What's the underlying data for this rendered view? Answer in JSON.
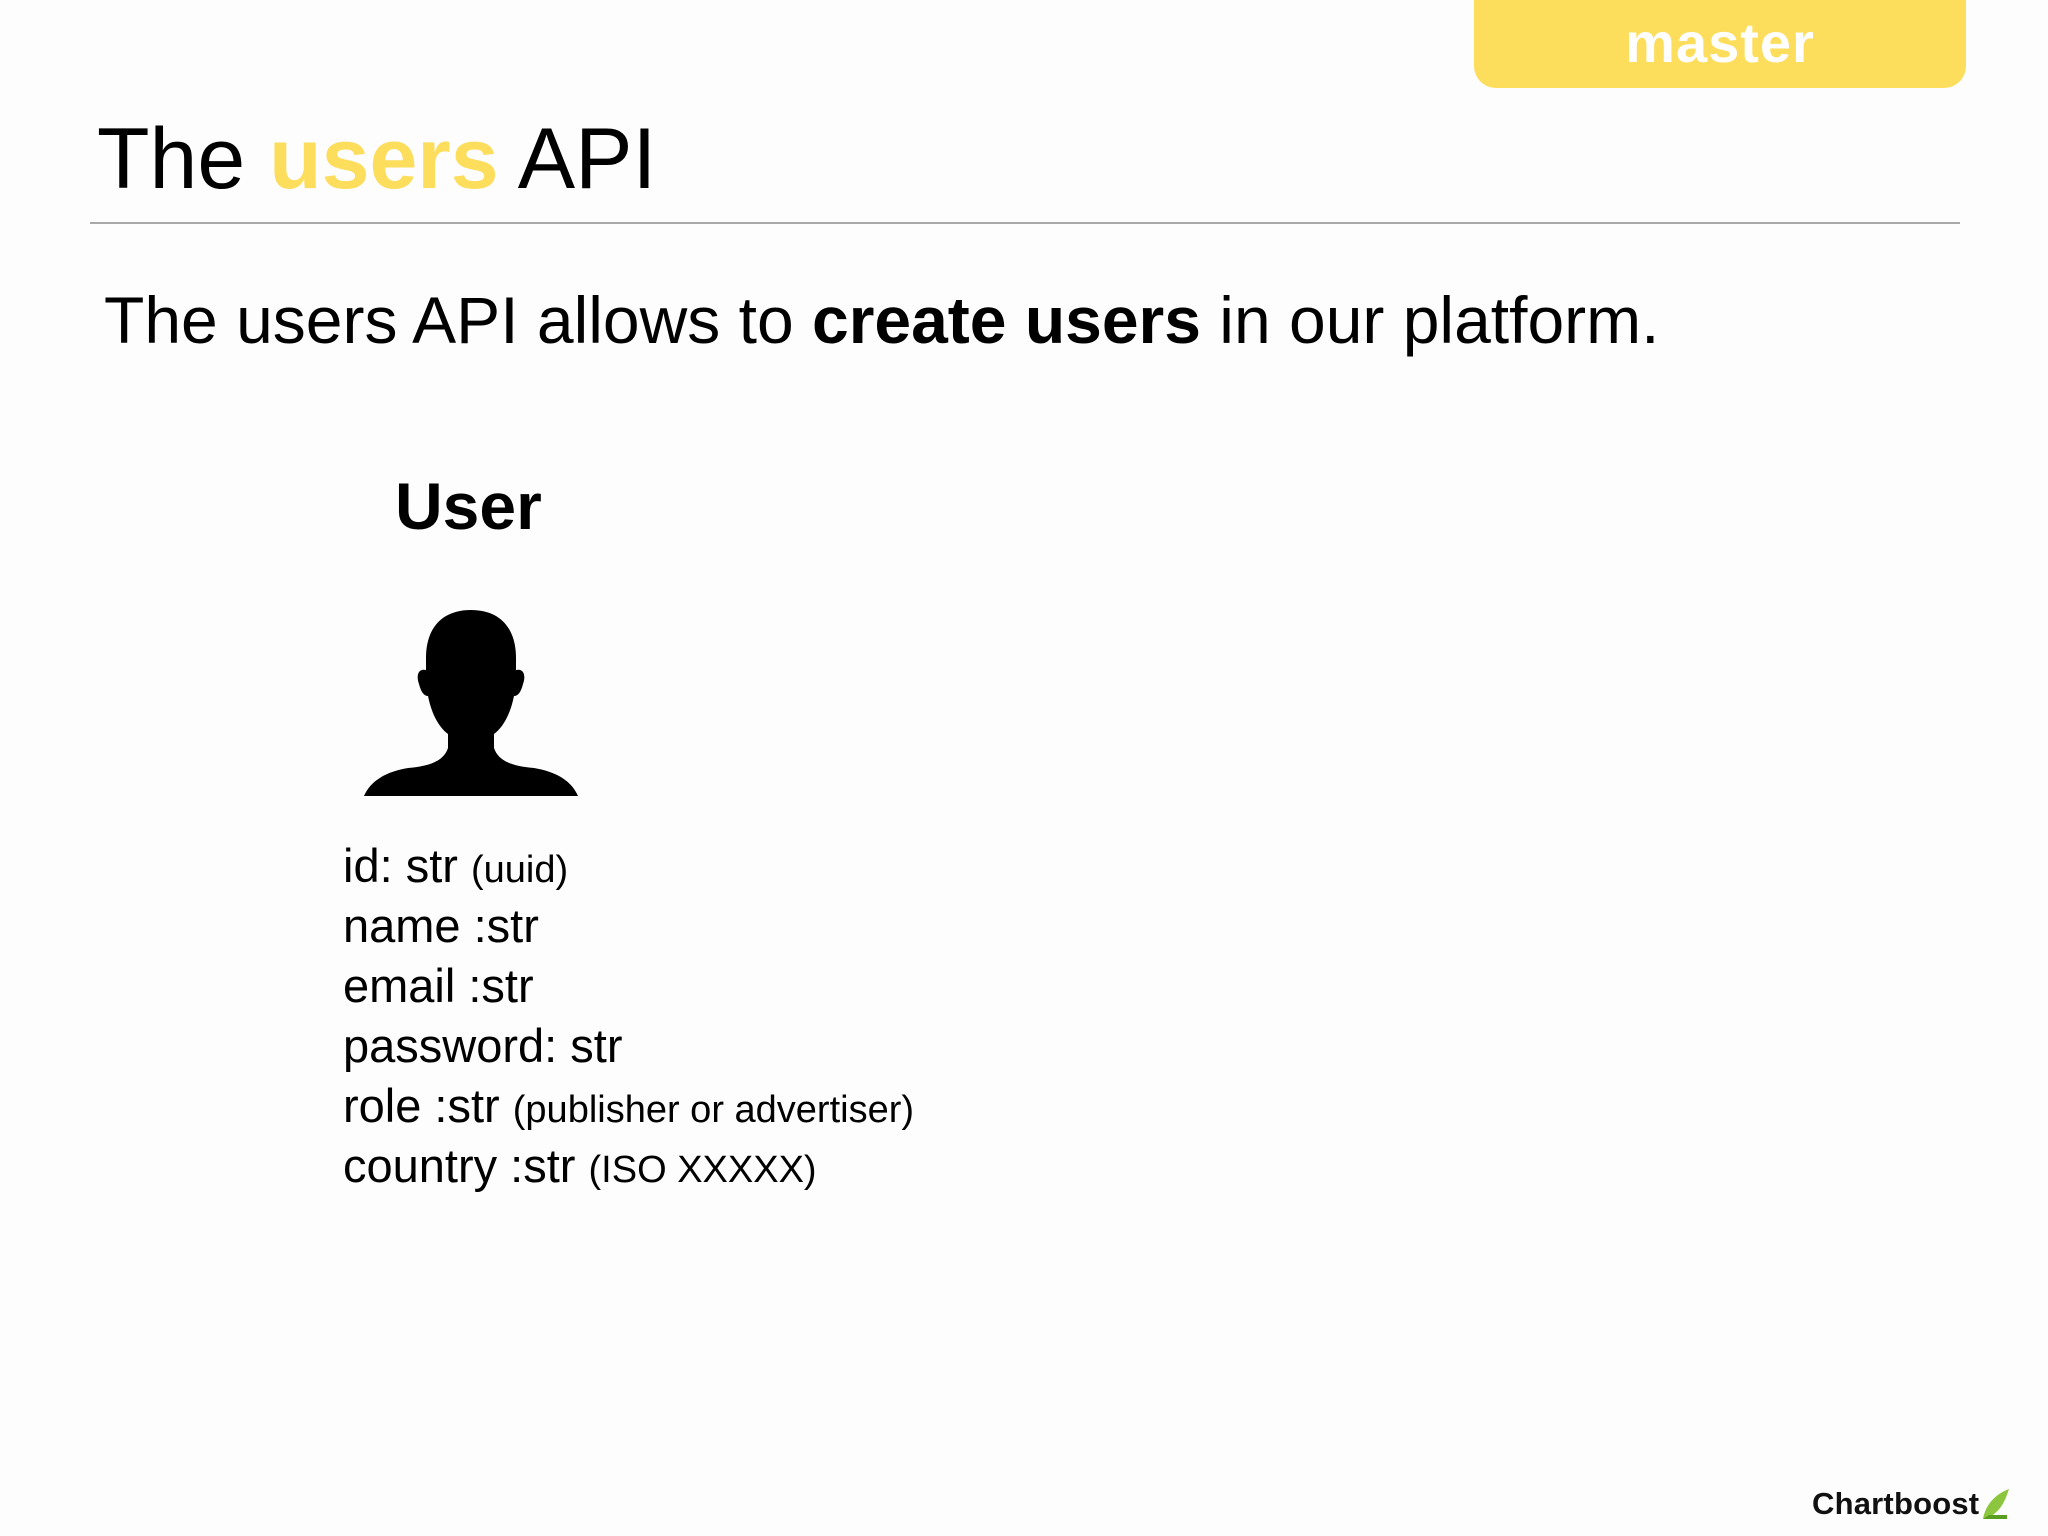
{
  "branch_badge": "master",
  "title": {
    "before": "The ",
    "accent": "users",
    "after": " API"
  },
  "intro": {
    "before": "The users API allows to ",
    "bold": "create users",
    "after": " in our platform."
  },
  "entity": {
    "title": "User",
    "icon": "user-silhouette-icon",
    "fields": [
      {
        "main": "id: str",
        "note": "(uuid)"
      },
      {
        "main": "name :str",
        "note": ""
      },
      {
        "main": "email :str",
        "note": ""
      },
      {
        "main": "password: str",
        "note": ""
      },
      {
        "main": "role :str",
        "note": "(publisher or advertiser)"
      },
      {
        "main": "country :str",
        "note": "(ISO XXXXX)"
      }
    ]
  },
  "logo": {
    "text": "Chartboost",
    "icon": "chartboost-leaf-icon"
  },
  "colors": {
    "accent": "#fddd5c",
    "logo_green": "#8cc63f"
  }
}
